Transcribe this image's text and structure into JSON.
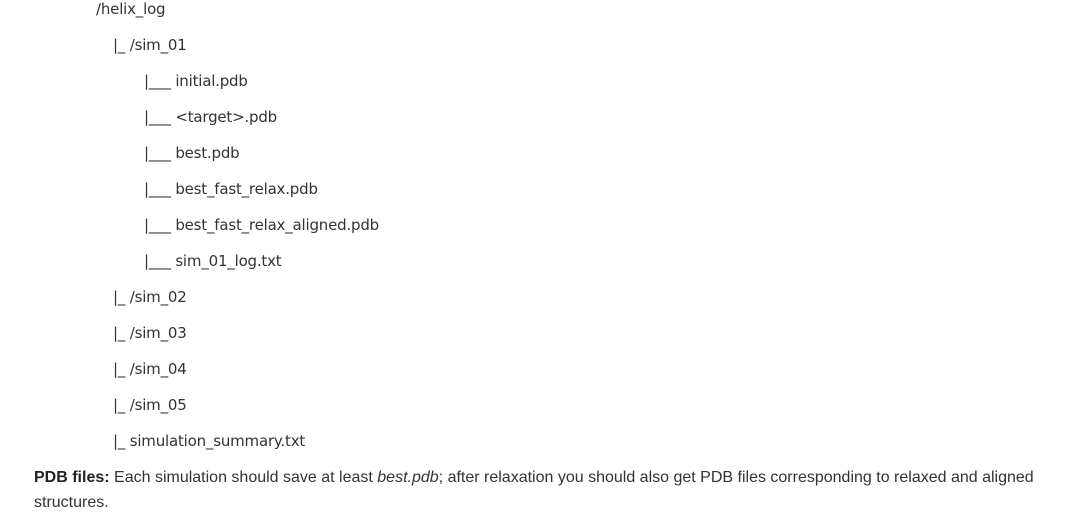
{
  "tree": {
    "root": "/helix_log",
    "sim01": "|_ /sim_01",
    "sim01_files": [
      "|___ initial.pdb",
      "|___ <target>.pdb",
      "|___ best.pdb",
      "|___ best_fast_relax.pdb",
      "|___ best_fast_relax_aligned.pdb",
      "|___ sim_01_log.txt"
    ],
    "sims": [
      "|_ /sim_02",
      "|_ /sim_03",
      "|_ /sim_04",
      "|_ /sim_05"
    ],
    "summary": "|_ simulation_summary.txt"
  },
  "paragraph": {
    "label": "PDB files:",
    "text_before": " Each simulation should save at least ",
    "emphasis": "best.pdb",
    "text_after": "; after relaxation you should also get PDB files corresponding to relaxed and aligned structures."
  }
}
